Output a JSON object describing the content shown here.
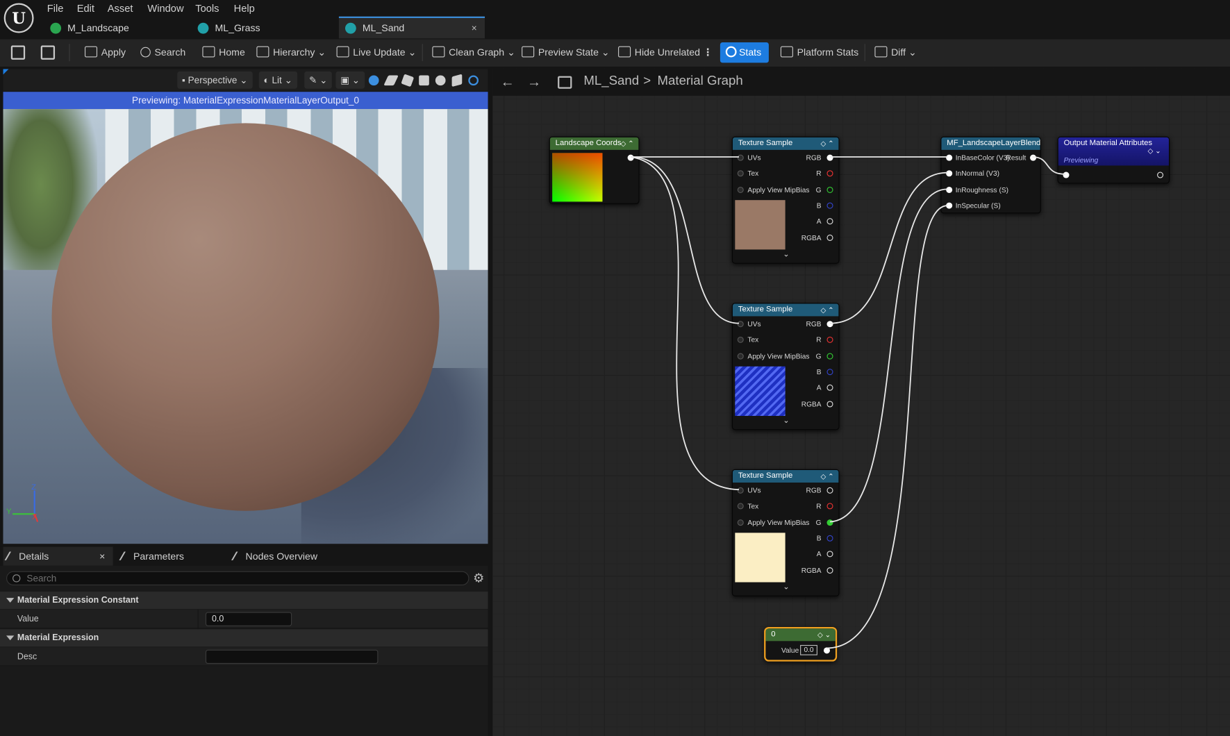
{
  "menu": [
    "File",
    "Edit",
    "Asset",
    "Window",
    "Tools",
    "Help"
  ],
  "tabs": [
    {
      "label": "M_Landscape"
    },
    {
      "label": "ML_Grass"
    },
    {
      "label": "ML_Sand",
      "close": "×"
    }
  ],
  "toolbar": {
    "apply": "Apply",
    "search": "Search",
    "home": "Home",
    "hierarchy": "Hierarchy",
    "live_update": "Live Update",
    "clean_graph": "Clean Graph",
    "preview_state": "Preview State",
    "hide_unrelated": "Hide Unrelated",
    "stats": "Stats",
    "platform_stats": "Platform Stats",
    "diff": "Diff"
  },
  "viewport": {
    "perspective": "Perspective",
    "lit": "Lit",
    "banner": "Previewing: MaterialExpressionMaterialLayerOutput_0",
    "axis_z": "Z",
    "axis_y": "Y",
    "axis_x": "X"
  },
  "details": {
    "tabs": [
      "Details",
      "Parameters",
      "Nodes Overview"
    ],
    "close": "×",
    "search_placeholder": "Search",
    "cat1": "Material Expression Constant",
    "value_label": "Value",
    "value": "0.0",
    "cat2": "Material Expression",
    "desc_label": "Desc",
    "desc_value": ""
  },
  "graph": {
    "crumb_asset": "ML_Sand",
    "crumb_sep": ">",
    "crumb_page": "Material Graph",
    "landscape_coords": {
      "title": "Landscape Coords"
    },
    "texture_samples": [
      {
        "title": "Texture Sample",
        "preview_color": "#9a7966"
      },
      {
        "title": "Texture Sample",
        "preview_color": "#2d3be6"
      },
      {
        "title": "Texture Sample",
        "preview_color": "#fbeec4"
      }
    ],
    "tex_inputs": [
      "UVs",
      "Tex",
      "Apply View MipBias"
    ],
    "tex_outputs": [
      "RGB",
      "R",
      "G",
      "B",
      "A",
      "RGBA"
    ],
    "layer_blend": {
      "title": "MF_LandscapeLayerBlend",
      "inputs": [
        "InBaseColor (V3)",
        "InNormal (V3)",
        "InRoughness (S)",
        "InSpecular (S)"
      ],
      "output": "Result"
    },
    "output_node": {
      "title": "Output Material Attributes",
      "subtitle": "Previewing"
    },
    "constant": {
      "title": "0",
      "value_label": "Value",
      "value": "0.0"
    }
  },
  "colors": {
    "accent": "#1d7ce0",
    "banner": "#3a5fd0",
    "selected_outline": "#f0a020",
    "node_tex_header": "#1f5a78",
    "node_coords_header": "#3d6b33",
    "node_output_header": "#1c1c8a"
  }
}
